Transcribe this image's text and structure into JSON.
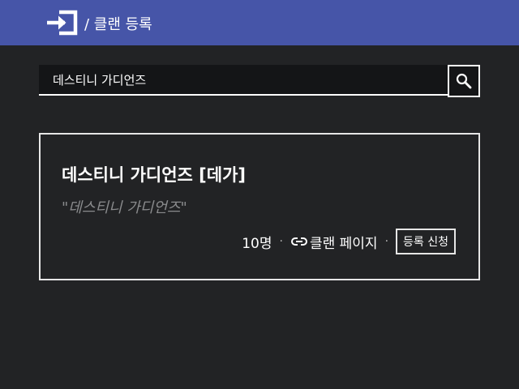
{
  "header": {
    "title": "/ 클랜 등록",
    "icon": "login-icon",
    "color": "#4655a8"
  },
  "search": {
    "value": "데스티니 가디언즈",
    "icon": "search-icon"
  },
  "result": {
    "name": "데스티니 가디언즈 [데가]",
    "motto": "\"데스티니 가디언즈\"",
    "members": "10명",
    "separator": "·",
    "link_label": "클랜 페이지",
    "link_icon": "link-icon",
    "register_label": "등록 신청"
  },
  "colors": {
    "background": "#222325",
    "input_background": "#141517",
    "muted_text": "#8a8b8d"
  }
}
